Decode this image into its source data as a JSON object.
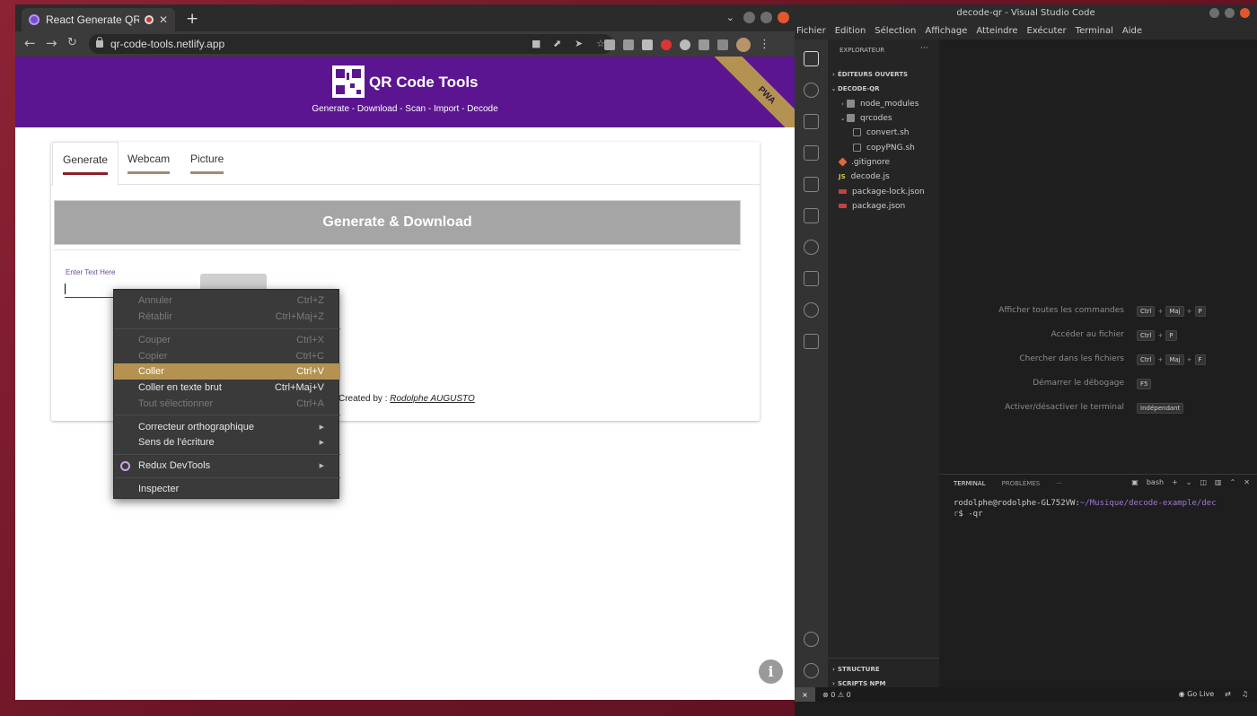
{
  "browser": {
    "tab_title": "React Generate QR Co",
    "new_tab": "+",
    "url": "qr-code-tools.netlify.app"
  },
  "app": {
    "title": "QR Code Tools",
    "subtitle": "Generate - Download - Scan - Import - Decode",
    "pwa_badge": "PWA",
    "tabs": [
      {
        "label": "Generate",
        "active": true
      },
      {
        "label": "Webcam",
        "active": false
      },
      {
        "label": "Picture",
        "active": false
      }
    ],
    "generate_button": "Generate & Download",
    "input_label": "Enter Text Here",
    "input_value": "",
    "credits_prefix": "Created by :",
    "credits_author": "Rodolphe AUGUSTO"
  },
  "context_menu": {
    "items": [
      {
        "label": "Annuler",
        "shortcut": "Ctrl+Z",
        "disabled": true
      },
      {
        "label": "Rétablir",
        "shortcut": "Ctrl+Maj+Z",
        "disabled": true
      },
      {
        "label": "Couper",
        "shortcut": "Ctrl+X",
        "disabled": true
      },
      {
        "label": "Copier",
        "shortcut": "Ctrl+C",
        "disabled": true
      },
      {
        "label": "Coller",
        "shortcut": "Ctrl+V",
        "highlighted": true
      },
      {
        "label": "Coller en texte brut",
        "shortcut": "Ctrl+Maj+V"
      },
      {
        "label": "Tout sélectionner",
        "shortcut": "Ctrl+A",
        "disabled": true
      },
      {
        "label": "Correcteur orthographique",
        "submenu": true
      },
      {
        "label": "Sens de l'écriture",
        "submenu": true
      },
      {
        "label": "Redux DevTools",
        "submenu": true
      },
      {
        "label": "Inspecter"
      }
    ]
  },
  "vscode": {
    "title": "decode-qr - Visual Studio Code",
    "menu": [
      "Fichier",
      "Edition",
      "Sélection",
      "Affichage",
      "Atteindre",
      "Exécuter",
      "Terminal",
      "Aide"
    ],
    "explorer_title": "EXPLORATEUR",
    "explorer_more": "···",
    "sections": {
      "open_editors": "ÉDITEURS OUVERTS",
      "project": "DECODE-QR",
      "structure": "STRUCTURE",
      "npm_scripts": "SCRIPTS NPM"
    },
    "tree": [
      {
        "label": "node_modules",
        "type": "folder"
      },
      {
        "label": "qrcodes",
        "type": "folder"
      },
      {
        "label": "convert.sh",
        "type": "shell"
      },
      {
        "label": "copyPNG.sh",
        "type": "shell"
      },
      {
        "label": ".gitignore",
        "type": "git"
      },
      {
        "label": "decode.js",
        "type": "js"
      },
      {
        "label": "package-lock.json",
        "type": "json"
      },
      {
        "label": "package.json",
        "type": "json"
      }
    ],
    "hints": [
      {
        "label": "Afficher toutes les commandes",
        "keys": [
          "Ctrl",
          "Maj",
          "P"
        ]
      },
      {
        "label": "Accéder au fichier",
        "keys": [
          "Ctrl",
          "P"
        ]
      },
      {
        "label": "Chercher dans les fichiers",
        "keys": [
          "Ctrl",
          "Maj",
          "F"
        ]
      },
      {
        "label": "Démarrer le débogage",
        "keys": [
          "F5"
        ]
      },
      {
        "label": "Activer/désactiver le terminal",
        "keys": [
          "Indépendant"
        ]
      }
    ],
    "panel": {
      "tab_terminal": "TERMINAL",
      "tab_problems": "PROBLÈMES",
      "more": "···",
      "shell": "bash",
      "prompt_user": "rodolphe@rodolphe-GL752VW",
      "prompt_path": "~/Musique/decode-example/dec",
      "prompt_line2_path": "r",
      "prompt_line2_rest": "$ -qr"
    },
    "status": {
      "errors": "0",
      "warnings": "0",
      "live": "Go Live"
    }
  }
}
